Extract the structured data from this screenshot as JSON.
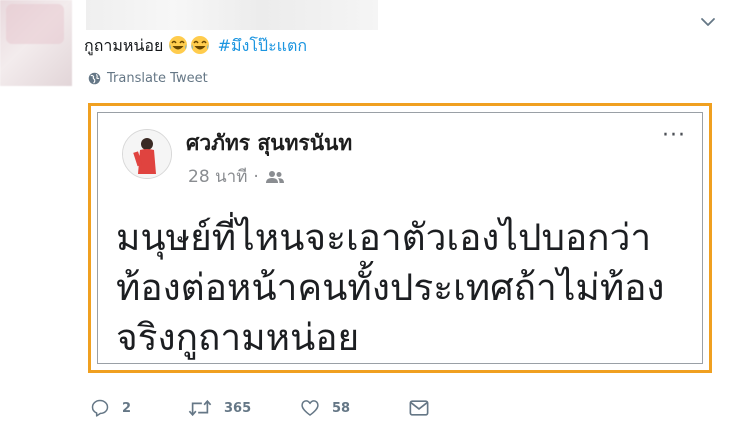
{
  "tweet": {
    "text": "กูถามหน่อย",
    "emoji": [
      "face-with-tears-of-joy",
      "face-with-tears-of-joy"
    ],
    "hashtag": "#มึงโป๊ะแตก",
    "translate_label": "Translate Tweet"
  },
  "embedded_post": {
    "author_name": "ศวภัทร สุนทรนันท",
    "time": "28 นาที",
    "separator": "·",
    "body_lines": [
      "มนุษย์ที่ไหนจะเอาตัวเองไปบอกว่า",
      "ท้องต่อหน้าคนทั้งประเทศถ้าไม่ท้อง",
      "จริงกูถามหน่อย"
    ],
    "more_label": "···"
  },
  "actions": {
    "reply_count": "2",
    "retweet_count": "365",
    "like_count": "58"
  },
  "colors": {
    "accent": "#1b95e0",
    "highlight_border": "#f0a020",
    "muted": "#657786"
  }
}
